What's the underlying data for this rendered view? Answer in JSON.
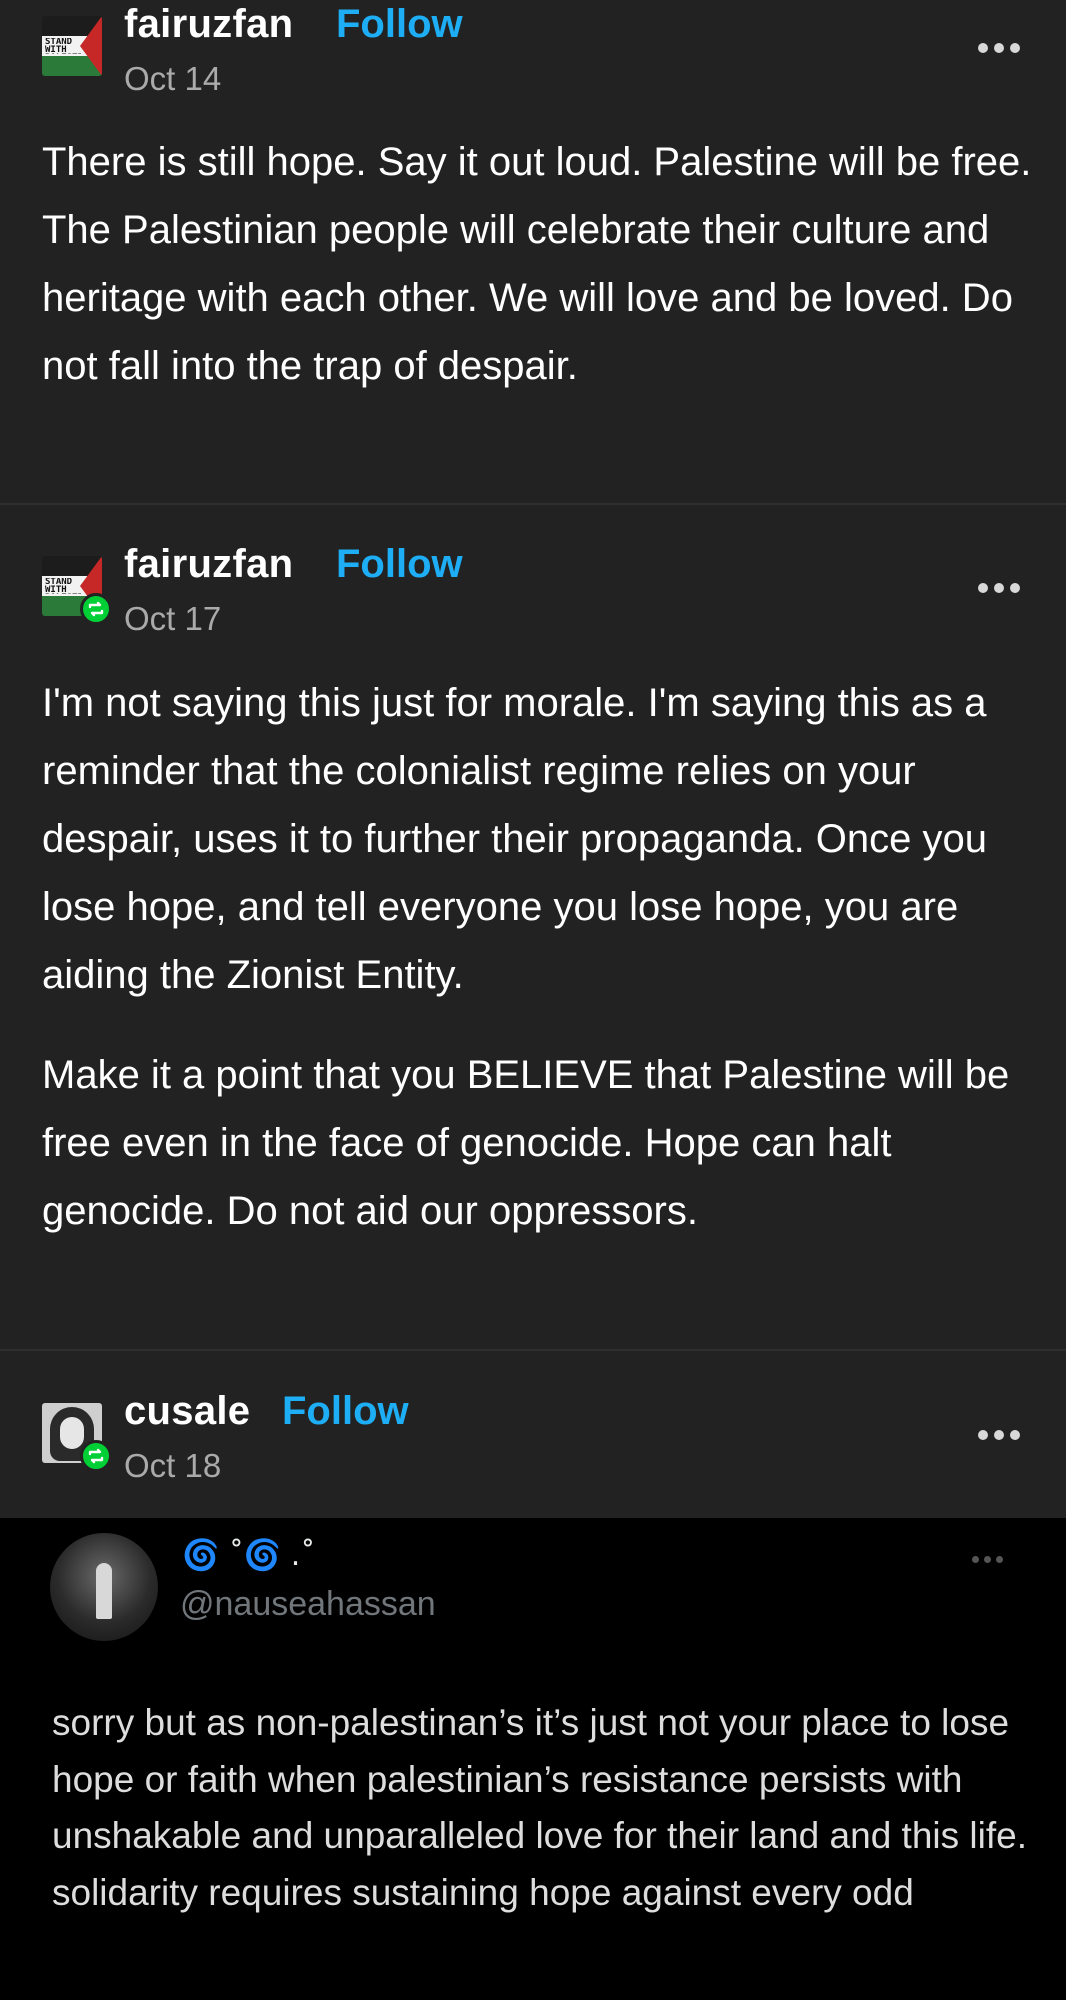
{
  "posts": [
    {
      "username": "fairuzfan",
      "follow_label": "Follow",
      "date": "Oct 14",
      "avatar": "stand-with-palestine-flag",
      "avatar_text": "STAND WITH PALESTINE",
      "reblogged": false,
      "paragraphs": [
        "There is still hope. Say it out loud. Palestine will be free. The Palestinian people will celebrate their culture and heritage with each other. We will love and be loved. Do not fall into the trap of despair."
      ]
    },
    {
      "username": "fairuzfan",
      "follow_label": "Follow",
      "date": "Oct 17",
      "avatar": "stand-with-palestine-flag",
      "avatar_text": "STAND WITH PALESTINE",
      "reblogged": true,
      "paragraphs": [
        "I'm not saying this just for morale. I'm saying this as a reminder that the colonialist regime relies on your despair, uses it to further their propaganda. Once you lose hope, and tell everyone you lose hope, you are aiding the Zionist Entity.",
        "Make it a point that you BELIEVE that Palestine will be free even in the face of genocide. Hope can halt genocide. Do not aid our oppressors."
      ]
    },
    {
      "username": "cusale",
      "follow_label": "Follow",
      "date": "Oct 18",
      "avatar": "portrait-photo",
      "reblogged": true
    }
  ],
  "embedded_tweet": {
    "display_name": "🌀 ˚🌀 .˚",
    "handle": "@nauseahassan",
    "text": "sorry but as non-palestinan’s it’s just not your place to lose hope or faith when palestinian’s resistance persists with unshakable and unparalleled love for their land and this life. solidarity requires sustaining hope against every odd"
  },
  "colors": {
    "background": "#222222",
    "follow": "#1eaef5",
    "reblog_badge": "#00cf35",
    "embed_background": "#000000"
  },
  "icons": [
    "more-options-icon",
    "reblog-icon"
  ]
}
